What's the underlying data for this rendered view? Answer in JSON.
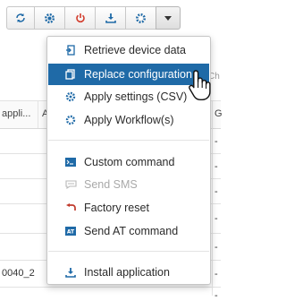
{
  "toolbar": {
    "buttons": [
      {
        "icon": "sync-icon",
        "label": "Refresh"
      },
      {
        "icon": "settings-icon",
        "label": "Settings"
      },
      {
        "icon": "power-icon",
        "label": "Reboot"
      },
      {
        "icon": "download-icon",
        "label": "Install"
      },
      {
        "icon": "gear-icon",
        "label": "Configure"
      },
      {
        "icon": "caret-down-icon",
        "label": "More"
      }
    ],
    "accent_color": "#1f6aa7"
  },
  "menu": {
    "items": [
      {
        "label": "Retrieve device data",
        "icon": "retrieve-data-icon",
        "state": "normal"
      },
      {
        "label": "Replace configuration",
        "icon": "replace-config-icon",
        "state": "highlighted"
      },
      {
        "label": "Apply settings (CSV)",
        "icon": "apply-settings-icon",
        "state": "normal"
      },
      {
        "label": "Apply Workflow(s)",
        "icon": "workflow-icon",
        "state": "normal"
      },
      {
        "label": "Custom command",
        "icon": "terminal-icon",
        "state": "normal"
      },
      {
        "label": "Send SMS",
        "icon": "sms-icon",
        "state": "disabled"
      },
      {
        "label": "Factory reset",
        "icon": "factory-reset-icon",
        "state": "normal"
      },
      {
        "label": "Send AT command",
        "icon": "at-command-icon",
        "state": "normal"
      },
      {
        "label": "Install application",
        "icon": "install-app-icon",
        "state": "normal"
      }
    ]
  },
  "background_table": {
    "headers": [
      "appli...",
      "A",
      "G"
    ],
    "clipped_text": "Ch",
    "cells": [
      "0040_2"
    ],
    "row_dashes": [
      "-",
      "-",
      "-",
      "-",
      "-",
      "-",
      "-",
      "-"
    ]
  }
}
